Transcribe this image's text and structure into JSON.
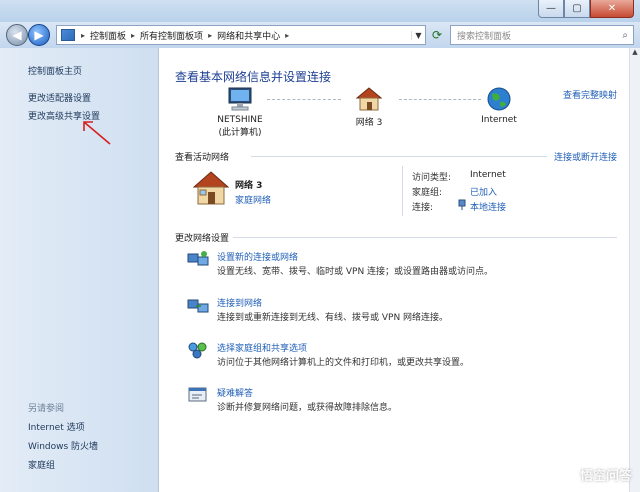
{
  "window": {
    "min_glyph": "—",
    "max_glyph": "▢",
    "close_glyph": "✕"
  },
  "address_bar": {
    "breadcrumbs": [
      "控制面板",
      "所有控制面板项",
      "网络和共享中心"
    ],
    "separator": "▸",
    "search_placeholder": "搜索控制面板"
  },
  "sidebar": {
    "links": [
      "控制面板主页",
      "更改适配器设置",
      "更改高级共享设置"
    ],
    "see_also_title": "另请参阅",
    "see_also": [
      "Internet 选项",
      "Windows 防火墙",
      "家庭组"
    ]
  },
  "main": {
    "title": "查看基本网络信息并设置连接",
    "view_full_map": "查看完整映射",
    "map_nodes": [
      {
        "line1": "NETSHINE",
        "line2": "(此计算机)",
        "icon": "computer-icon"
      },
      {
        "line1": "网络  3",
        "line2": "",
        "icon": "home-network-icon"
      },
      {
        "line1": "Internet",
        "line2": "",
        "icon": "globe-icon"
      }
    ],
    "active_networks": {
      "header": "查看活动网络",
      "connect_link": "连接或断开连接",
      "network_name": "网络  3",
      "network_type": "家庭网络",
      "access_type_label": "访问类型:",
      "access_type_value": "Internet",
      "homegroup_label": "家庭组:",
      "homegroup_value": "已加入",
      "connection_label": "连接:",
      "connection_value": "本地连接"
    },
    "change_settings": {
      "header": "更改网络设置",
      "tasks": [
        {
          "title": "设置新的连接或网络",
          "desc": "设置无线、宽带、拨号、临时或 VPN 连接；或设置路由器或访问点。",
          "icon": "new-connection-icon"
        },
        {
          "title": "连接到网络",
          "desc": "连接到或重新连接到无线、有线、拨号或 VPN 网络连接。",
          "icon": "connect-network-icon"
        },
        {
          "title": "选择家庭组和共享选项",
          "desc": "访问位于其他网络计算机上的文件和打印机，或更改共享设置。",
          "icon": "homegroup-icon"
        },
        {
          "title": "疑难解答",
          "desc": "诊断并修复网络问题，或获得故障排除信息。",
          "icon": "troubleshoot-icon"
        }
      ]
    }
  },
  "watermark": {
    "text": "悟空问答"
  }
}
